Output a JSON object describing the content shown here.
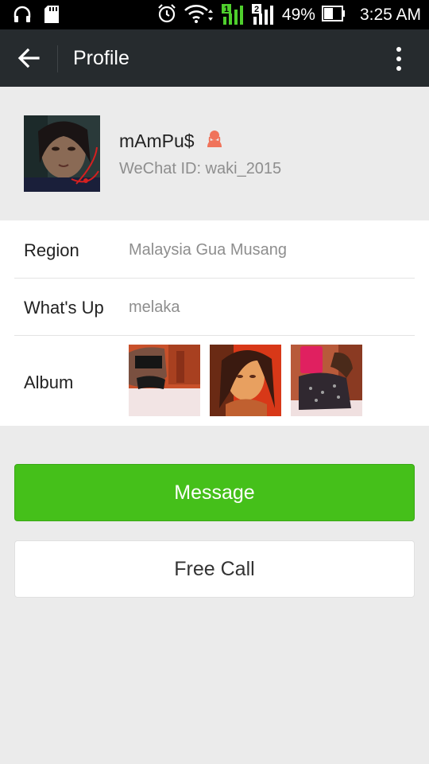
{
  "status_bar": {
    "battery_percent": "49%",
    "time": "3:25 AM",
    "icons": [
      "headset-icon",
      "sd-card-icon",
      "alarm-icon",
      "wifi-icon",
      "signal-sim1-icon",
      "signal-sim2-icon",
      "battery-icon"
    ]
  },
  "appbar": {
    "title": "Profile",
    "back_icon": "arrow-left-icon",
    "menu_icon": "more-vertical-icon"
  },
  "profile": {
    "nickname": "mAmPu$",
    "gender_icon": "female-icon",
    "wechat_id": "WeChat ID: waki_2015"
  },
  "info": {
    "region_label": "Region",
    "region_value": "Malaysia  Gua Musang",
    "whatsup_label": "What's Up",
    "whatsup_value": "melaka",
    "album_label": "Album"
  },
  "actions": {
    "message": "Message",
    "free_call": "Free Call"
  },
  "colors": {
    "appbar": "#262b2e",
    "accent_green": "#45c01a",
    "background": "#ebebeb",
    "female_icon": "#f0735a"
  }
}
